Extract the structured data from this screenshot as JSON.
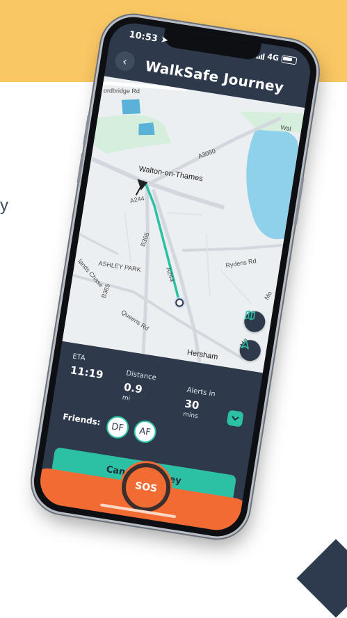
{
  "background": {
    "partial_text": "y",
    "banner_color": "#F9C763",
    "corner_color": "#2E3B4E"
  },
  "status_bar": {
    "time": "10:53",
    "network": "4G"
  },
  "header": {
    "title": "WalkSafe Journey",
    "back_icon": "chevron-left-icon"
  },
  "map": {
    "labels": {
      "ordbridge_rd": "ordbridge Rd",
      "a3050": "A3050",
      "walton": "Walton-on-Thames",
      "a244_top": "A244",
      "b365": "B365",
      "ashley_park": "ASHLEY PARK",
      "ryden_rd": "Rydens Rd",
      "a244_mid": "A244",
      "lands_chase": "lands Chase",
      "b365_lower": "B365",
      "queens_rd": "Queens Rd",
      "hersham": "Hersham",
      "molesey": "Mo",
      "wal": "Wal",
      "mo2": "Mo"
    },
    "route_color": "#2CC0A5",
    "water_color": "#8FD0EA",
    "park_color": "#D6EEDC",
    "map_button_icon": "map-icon",
    "navigate_button_icon": "navigation-arrow-icon"
  },
  "journey": {
    "eta_label": "ETA",
    "eta_value": "11:19",
    "distance_label": "Distance",
    "distance_value": "0.9",
    "distance_unit": "mi",
    "alerts_label": "Alerts in",
    "alerts_value": "30",
    "alerts_unit": "mins",
    "expand_icon": "chevron-down-icon"
  },
  "friends": {
    "label": "Friends:",
    "list": [
      "DF",
      "AF"
    ]
  },
  "actions": {
    "cancel_label": "Cancel Journey",
    "sos_label": "SOS",
    "accent_color": "#2CC0A5",
    "sos_color": "#F26B32"
  }
}
